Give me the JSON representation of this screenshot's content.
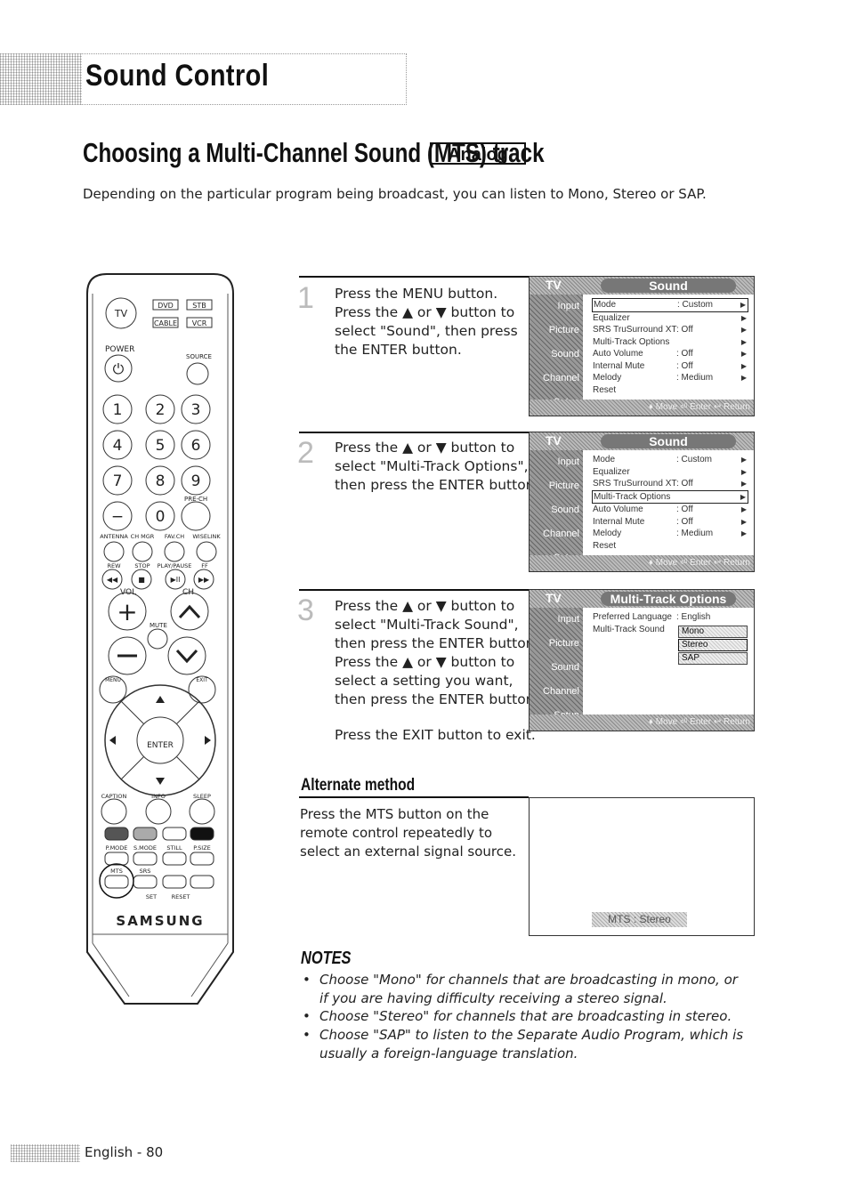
{
  "header": {
    "title": "Sound Control"
  },
  "section": {
    "title": "Choosing a Multi-Channel Sound (MTS) track",
    "badge": "Analog",
    "intro": "Depending on the particular program being broadcast, you can listen to Mono, Stereo or SAP."
  },
  "steps": [
    {
      "num": "1",
      "text": "Press the MENU button.\nPress the ▲ or ▼ button to\nselect \"Sound\", then press\nthe ENTER button."
    },
    {
      "num": "2",
      "text": "Press the ▲ or ▼ button to\nselect \"Multi-Track Options\",\nthen press the ENTER button."
    },
    {
      "num": "3",
      "text": "Press the ▲ or ▼ button to\nselect \"Multi-Track Sound\",\nthen press the ENTER button.\nPress the ▲ or ▼ button to\nselect a setting you want,\nthen press the ENTER button.",
      "extra": "Press the EXIT button to exit."
    }
  ],
  "osd": {
    "tv": "TV",
    "side": [
      "Input",
      "Picture",
      "Sound",
      "Channel",
      "Setup"
    ],
    "footer": "♦ Move   ⏎ Enter   ↩ Return",
    "sound_title": "Sound",
    "sound_items": [
      {
        "label": "Mode",
        "value": ": Custom"
      },
      {
        "label": "Equalizer",
        "value": ""
      },
      {
        "label": "SRS TruSurround XT",
        "value": ": Off"
      },
      {
        "label": "Multi-Track Options",
        "value": ""
      },
      {
        "label": "Auto Volume",
        "value": ": Off"
      },
      {
        "label": "Internal Mute",
        "value": ": Off"
      },
      {
        "label": "Melody",
        "value": ": Medium"
      },
      {
        "label": "Reset",
        "value": ""
      }
    ],
    "mts_title": "Multi-Track Options",
    "mts_items": [
      {
        "label": "Preferred Language",
        "value": ": English"
      },
      {
        "label": "Multi-Track Sound",
        "value": ""
      }
    ],
    "mts_options": [
      "Mono",
      "Stereo",
      "SAP"
    ]
  },
  "alternate": {
    "heading": "Alternate method",
    "text": "Press the MTS button on the remote control repeatedly to select an external signal source.",
    "osd_label": "MTS : Stereo"
  },
  "notes": {
    "heading": "NOTES",
    "items": [
      "Choose \"Mono\" for channels that are broadcasting in mono, or if you are having difficulty receiving a stereo signal.",
      "Choose \"Stereo\" for channels that are broadcasting in stereo.",
      "Choose \"SAP\" to listen to the Separate Audio Program, which is usually a foreign-language translation."
    ]
  },
  "footer": {
    "page": "English - 80"
  },
  "remote": {
    "tv": "TV",
    "dvd": "DVD",
    "stb": "STB",
    "cable": "CABLE",
    "vcr": "VCR",
    "power": "POWER",
    "source": "SOURCE",
    "digits": [
      "1",
      "2",
      "3",
      "4",
      "5",
      "6",
      "7",
      "8",
      "9",
      "0"
    ],
    "dash": "−",
    "prech": "PRE-CH",
    "row_labels": [
      "ANTENNA",
      "CH MGR",
      "FAV.CH",
      "WISELINK"
    ],
    "transport_labels": [
      "REW",
      "STOP",
      "PLAY/PAUSE",
      "FF"
    ],
    "transport_icons": [
      "◀◀",
      "■",
      "▶II",
      "▶▶"
    ],
    "vol": "VOL",
    "ch": "CH",
    "mute": "MUTE",
    "menu": "MENU",
    "exit": "EXIT",
    "enter": "ENTER",
    "func_labels": [
      "CAPTION",
      "INFO",
      "SLEEP"
    ],
    "mode_labels": [
      "P.MODE",
      "S.MODE",
      "STILL",
      "P.SIZE"
    ],
    "mts": "MTS",
    "srs": "SRS",
    "set": "SET",
    "reset": "RESET",
    "brand": "SAMSUNG"
  }
}
